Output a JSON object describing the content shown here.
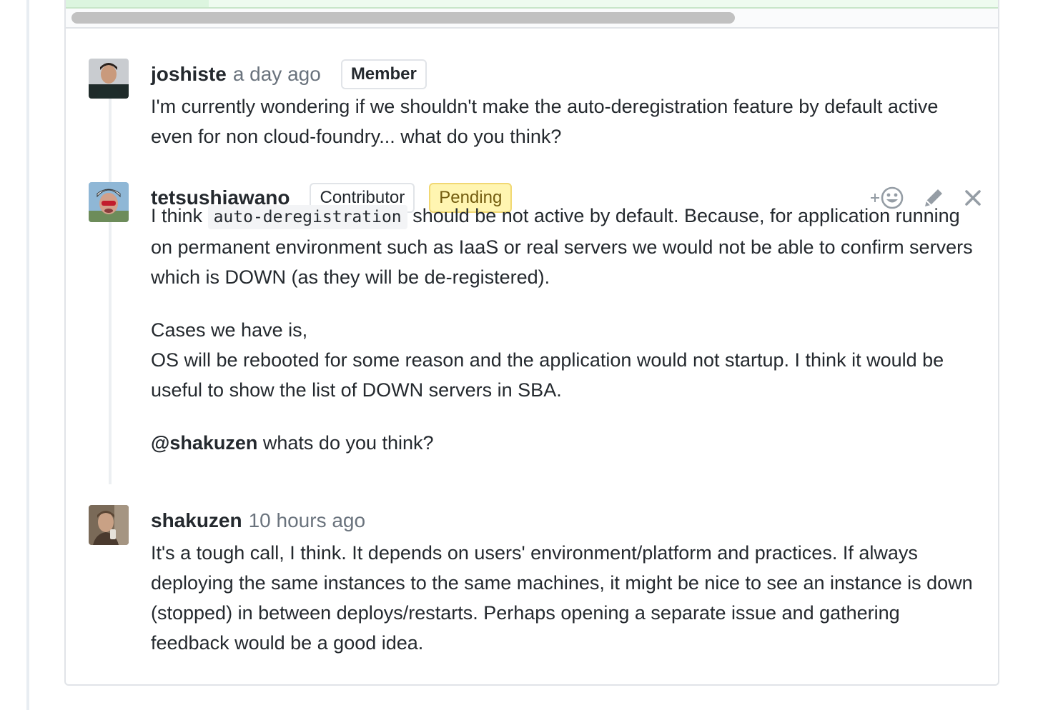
{
  "comments": [
    {
      "author": "joshiste",
      "time": "a day ago",
      "badge": "Member",
      "paragraphs": [
        "I'm currently wondering if we shouldn't make the auto-deregistration feature by default active even for non cloud-foundry... what do you think?"
      ]
    },
    {
      "author": "tetsushiawano",
      "badge": "Contributor",
      "status": "Pending",
      "p1_before": "I think",
      "p1_code": "auto-deregistration",
      "p1_after": "should be not active by default. Because, for application running on permanent environment such as IaaS or real servers we would not be able to confirm servers which is DOWN (as they will be de-registered).",
      "p2_line1": "Cases we have is,",
      "p2_line2": "OS will be rebooted for some reason and the application would not startup. I think it would be useful to show the list of DOWN servers in SBA.",
      "p3_mention": "@shakuzen",
      "p3_rest": "whats do you think?",
      "actions": {
        "reaction_icon": "add-reaction-icon",
        "edit_icon": "pencil-icon",
        "delete_icon": "close-icon"
      }
    },
    {
      "author": "shakuzen",
      "time": "10 hours ago",
      "paragraphs": [
        "It's a tough call, I think. It depends on users' environment/platform and practices. If always deploying the same instances to the same machines, it might be nice to see an instance is down (stopped) in between deploys/restarts. Perhaps opening a separate issue and gathering feedback would be a good idea."
      ]
    }
  ],
  "colors": {
    "badge_pending_bg": "#fff5b1",
    "text": "#24292e",
    "muted": "#6a737d"
  }
}
